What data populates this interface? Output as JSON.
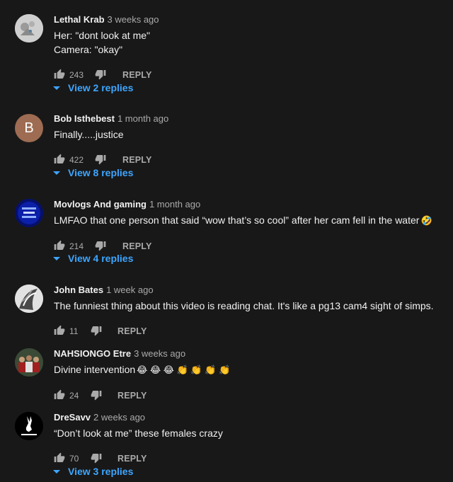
{
  "comments": [
    {
      "author": "Lethal Krab",
      "time": "3 weeks ago",
      "text": [
        "Her: \"dont look at me\"",
        "Camera: \"okay\""
      ],
      "likes": "243",
      "reply": "REPLY",
      "view_replies": "View 2 replies",
      "avatar": "grey-avatar-icon"
    },
    {
      "author": "Bob Isthebest",
      "time": "1 month ago",
      "text": [
        "Finally.....justice"
      ],
      "likes": "422",
      "reply": "REPLY",
      "view_replies": "View 8 replies",
      "avatar_letter": "B",
      "avatar_color": "#9e6c52"
    },
    {
      "author": "Movlogs And gaming",
      "time": "1 month ago",
      "text": [
        "LMFAO that one person that said “wow that’s so cool” after her cam fell in the water"
      ],
      "emoji": "🤣",
      "likes": "214",
      "reply": "REPLY",
      "view_replies": "View 4 replies",
      "avatar": "blue-channel-avatar-icon"
    },
    {
      "author": "John Bates",
      "time": "1 week ago",
      "text": [
        "The funniest thing about this video is reading chat. It's like a pg13 cam4 sight of simps."
      ],
      "likes": "11",
      "reply": "REPLY",
      "avatar": "bw-avatar-icon"
    },
    {
      "author": "NAHSIONGO Etre",
      "time": "3 weeks ago",
      "text": [
        "Divine intervention"
      ],
      "emoji": "😂 😂 😂 👏 👏 👏 👏",
      "likes": "24",
      "reply": "REPLY",
      "avatar": "group-avatar-icon"
    },
    {
      "author": "DreSavv",
      "time": "2 weeks ago",
      "text": [
        "“Don’t look at me” these females crazy"
      ],
      "likes": "70",
      "reply": "REPLY",
      "view_replies": "View 3 replies",
      "avatar": "playboy-bunny-avatar-icon"
    }
  ],
  "colors": {
    "background": "#181818",
    "link": "#3ea6ff",
    "secondary": "#aaaaaa"
  }
}
